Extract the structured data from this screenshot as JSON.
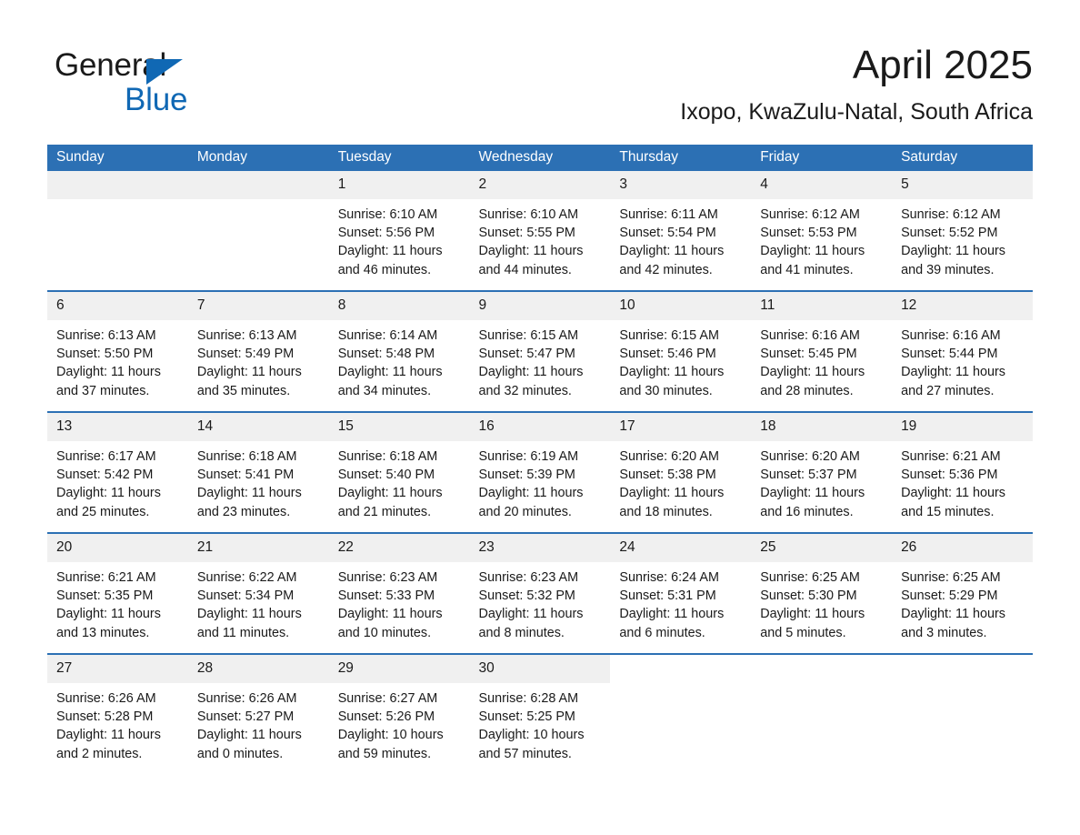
{
  "brand": {
    "name_part1": "General",
    "name_part2": "Blue",
    "accent_color": "#1068b4",
    "logo_icon": "triangle-flag-icon"
  },
  "header": {
    "month_title": "April 2025",
    "location": "Ixopo, KwaZulu-Natal, South Africa"
  },
  "theme": {
    "header_bg": "#2c70b4",
    "date_band_bg": "#f0f0f0",
    "row_divider": "#2c70b4",
    "text": "#1a1a1a"
  },
  "calendar": {
    "weekday_headers": [
      "Sunday",
      "Monday",
      "Tuesday",
      "Wednesday",
      "Thursday",
      "Friday",
      "Saturday"
    ],
    "weeks": [
      [
        {
          "date": "",
          "blank": true,
          "lines": []
        },
        {
          "date": "",
          "blank": true,
          "lines": []
        },
        {
          "date": "1",
          "lines": [
            "Sunrise: 6:10 AM",
            "Sunset: 5:56 PM",
            "Daylight: 11 hours",
            "and 46 minutes."
          ]
        },
        {
          "date": "2",
          "lines": [
            "Sunrise: 6:10 AM",
            "Sunset: 5:55 PM",
            "Daylight: 11 hours",
            "and 44 minutes."
          ]
        },
        {
          "date": "3",
          "lines": [
            "Sunrise: 6:11 AM",
            "Sunset: 5:54 PM",
            "Daylight: 11 hours",
            "and 42 minutes."
          ]
        },
        {
          "date": "4",
          "lines": [
            "Sunrise: 6:12 AM",
            "Sunset: 5:53 PM",
            "Daylight: 11 hours",
            "and 41 minutes."
          ]
        },
        {
          "date": "5",
          "lines": [
            "Sunrise: 6:12 AM",
            "Sunset: 5:52 PM",
            "Daylight: 11 hours",
            "and 39 minutes."
          ]
        }
      ],
      [
        {
          "date": "6",
          "lines": [
            "Sunrise: 6:13 AM",
            "Sunset: 5:50 PM",
            "Daylight: 11 hours",
            "and 37 minutes."
          ]
        },
        {
          "date": "7",
          "lines": [
            "Sunrise: 6:13 AM",
            "Sunset: 5:49 PM",
            "Daylight: 11 hours",
            "and 35 minutes."
          ]
        },
        {
          "date": "8",
          "lines": [
            "Sunrise: 6:14 AM",
            "Sunset: 5:48 PM",
            "Daylight: 11 hours",
            "and 34 minutes."
          ]
        },
        {
          "date": "9",
          "lines": [
            "Sunrise: 6:15 AM",
            "Sunset: 5:47 PM",
            "Daylight: 11 hours",
            "and 32 minutes."
          ]
        },
        {
          "date": "10",
          "lines": [
            "Sunrise: 6:15 AM",
            "Sunset: 5:46 PM",
            "Daylight: 11 hours",
            "and 30 minutes."
          ]
        },
        {
          "date": "11",
          "lines": [
            "Sunrise: 6:16 AM",
            "Sunset: 5:45 PM",
            "Daylight: 11 hours",
            "and 28 minutes."
          ]
        },
        {
          "date": "12",
          "lines": [
            "Sunrise: 6:16 AM",
            "Sunset: 5:44 PM",
            "Daylight: 11 hours",
            "and 27 minutes."
          ]
        }
      ],
      [
        {
          "date": "13",
          "lines": [
            "Sunrise: 6:17 AM",
            "Sunset: 5:42 PM",
            "Daylight: 11 hours",
            "and 25 minutes."
          ]
        },
        {
          "date": "14",
          "lines": [
            "Sunrise: 6:18 AM",
            "Sunset: 5:41 PM",
            "Daylight: 11 hours",
            "and 23 minutes."
          ]
        },
        {
          "date": "15",
          "lines": [
            "Sunrise: 6:18 AM",
            "Sunset: 5:40 PM",
            "Daylight: 11 hours",
            "and 21 minutes."
          ]
        },
        {
          "date": "16",
          "lines": [
            "Sunrise: 6:19 AM",
            "Sunset: 5:39 PM",
            "Daylight: 11 hours",
            "and 20 minutes."
          ]
        },
        {
          "date": "17",
          "lines": [
            "Sunrise: 6:20 AM",
            "Sunset: 5:38 PM",
            "Daylight: 11 hours",
            "and 18 minutes."
          ]
        },
        {
          "date": "18",
          "lines": [
            "Sunrise: 6:20 AM",
            "Sunset: 5:37 PM",
            "Daylight: 11 hours",
            "and 16 minutes."
          ]
        },
        {
          "date": "19",
          "lines": [
            "Sunrise: 6:21 AM",
            "Sunset: 5:36 PM",
            "Daylight: 11 hours",
            "and 15 minutes."
          ]
        }
      ],
      [
        {
          "date": "20",
          "lines": [
            "Sunrise: 6:21 AM",
            "Sunset: 5:35 PM",
            "Daylight: 11 hours",
            "and 13 minutes."
          ]
        },
        {
          "date": "21",
          "lines": [
            "Sunrise: 6:22 AM",
            "Sunset: 5:34 PM",
            "Daylight: 11 hours",
            "and 11 minutes."
          ]
        },
        {
          "date": "22",
          "lines": [
            "Sunrise: 6:23 AM",
            "Sunset: 5:33 PM",
            "Daylight: 11 hours",
            "and 10 minutes."
          ]
        },
        {
          "date": "23",
          "lines": [
            "Sunrise: 6:23 AM",
            "Sunset: 5:32 PM",
            "Daylight: 11 hours",
            "and 8 minutes."
          ]
        },
        {
          "date": "24",
          "lines": [
            "Sunrise: 6:24 AM",
            "Sunset: 5:31 PM",
            "Daylight: 11 hours",
            "and 6 minutes."
          ]
        },
        {
          "date": "25",
          "lines": [
            "Sunrise: 6:25 AM",
            "Sunset: 5:30 PM",
            "Daylight: 11 hours",
            "and 5 minutes."
          ]
        },
        {
          "date": "26",
          "lines": [
            "Sunrise: 6:25 AM",
            "Sunset: 5:29 PM",
            "Daylight: 11 hours",
            "and 3 minutes."
          ]
        }
      ],
      [
        {
          "date": "27",
          "lines": [
            "Sunrise: 6:26 AM",
            "Sunset: 5:28 PM",
            "Daylight: 11 hours",
            "and 2 minutes."
          ]
        },
        {
          "date": "28",
          "lines": [
            "Sunrise: 6:26 AM",
            "Sunset: 5:27 PM",
            "Daylight: 11 hours",
            "and 0 minutes."
          ]
        },
        {
          "date": "29",
          "lines": [
            "Sunrise: 6:27 AM",
            "Sunset: 5:26 PM",
            "Daylight: 10 hours",
            "and 59 minutes."
          ]
        },
        {
          "date": "30",
          "lines": [
            "Sunrise: 6:28 AM",
            "Sunset: 5:25 PM",
            "Daylight: 10 hours",
            "and 57 minutes."
          ]
        },
        {
          "date": "",
          "blank": true,
          "lines": []
        },
        {
          "date": "",
          "blank": true,
          "lines": []
        },
        {
          "date": "",
          "blank": true,
          "lines": []
        }
      ]
    ]
  }
}
